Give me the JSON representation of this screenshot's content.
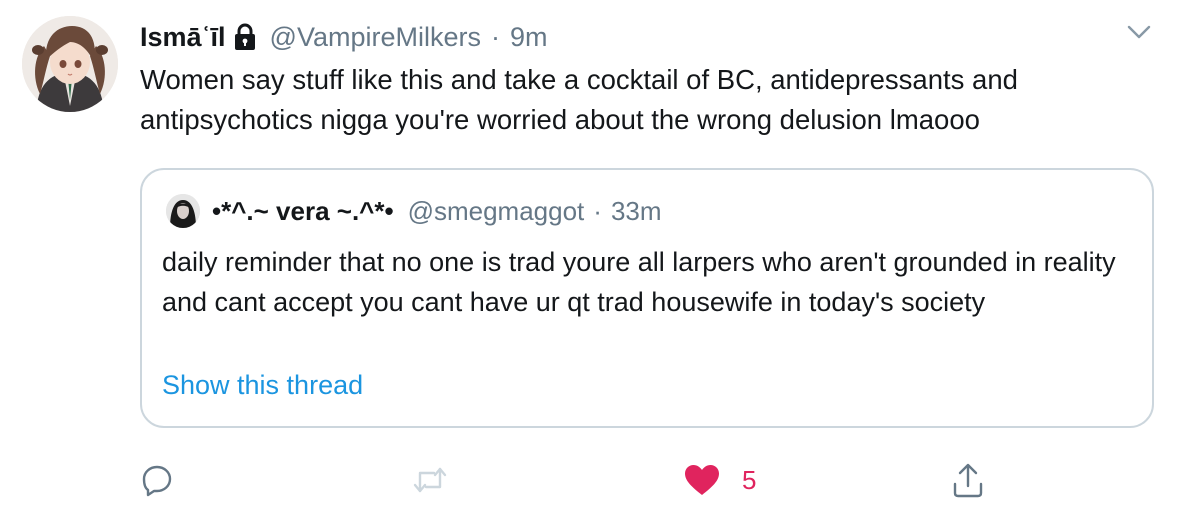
{
  "tweet": {
    "display_name": "Ismāʿīl",
    "handle": "@VampireMilkers",
    "separator": "·",
    "time": "9m",
    "text": "Women say stuff like this and take a cocktail of BC, antidepressants and antipsychotics nigga you're worried about the wrong delusion lmaooo",
    "protected_icon": "lock-icon",
    "menu_icon": "chevron-down-icon"
  },
  "quote": {
    "display_name": "•*^.~ vera ~.^*•",
    "handle": "@smegmaggot",
    "separator": "·",
    "time": "33m",
    "text": "daily reminder that no one is trad youre all larpers who aren't grounded in reality and cant accept you cant have ur qt trad housewife in today's society",
    "show_thread": "Show this thread"
  },
  "actions": {
    "reply_icon": "reply-icon",
    "retweet_icon": "retweet-icon",
    "like_icon": "heart-icon",
    "like_count": "5",
    "share_icon": "share-icon"
  },
  "colors": {
    "text": "#14171a",
    "secondary": "#657786",
    "link": "#1b95e0",
    "like": "#e0245e",
    "border": "#ccd6dd"
  }
}
